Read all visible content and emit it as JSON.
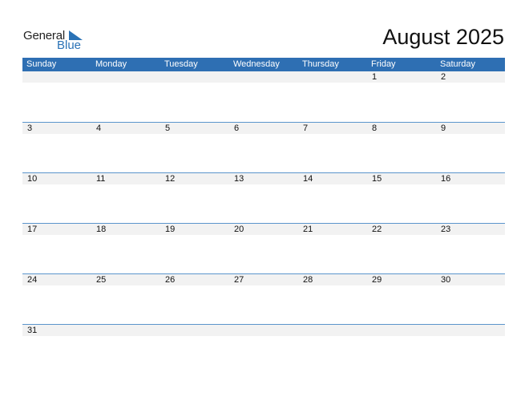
{
  "logo": {
    "line1": "General",
    "line2": "Blue"
  },
  "title": "August 2025",
  "weekdays": [
    "Sunday",
    "Monday",
    "Tuesday",
    "Wednesday",
    "Thursday",
    "Friday",
    "Saturday"
  ],
  "weeks": [
    [
      "",
      "",
      "",
      "",
      "",
      "1",
      "2"
    ],
    [
      "3",
      "4",
      "5",
      "6",
      "7",
      "8",
      "9"
    ],
    [
      "10",
      "11",
      "12",
      "13",
      "14",
      "15",
      "16"
    ],
    [
      "17",
      "18",
      "19",
      "20",
      "21",
      "22",
      "23"
    ],
    [
      "24",
      "25",
      "26",
      "27",
      "28",
      "29",
      "30"
    ],
    [
      "31",
      "",
      "",
      "",
      "",
      "",
      ""
    ]
  ],
  "colors": {
    "accent": "#2e6fb3",
    "band": "#f2f2f2"
  }
}
